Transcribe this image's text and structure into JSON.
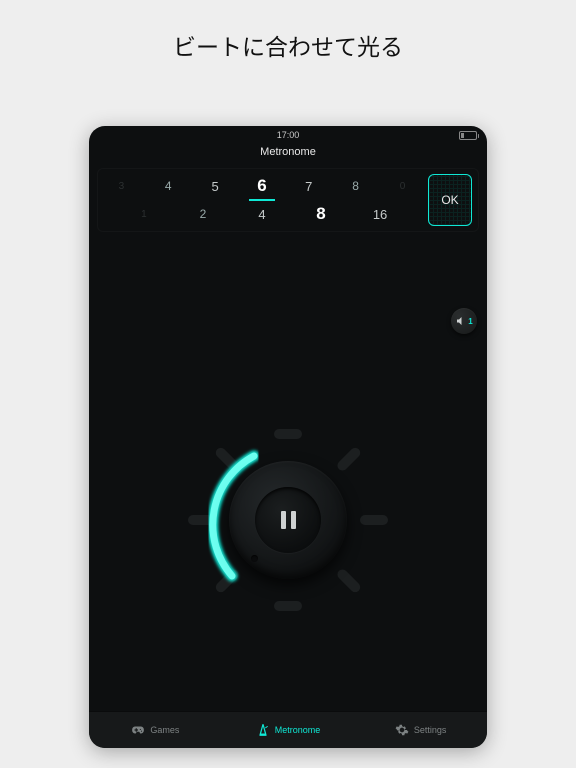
{
  "headline": "ビートに合わせて光る",
  "status": {
    "time": "17:00"
  },
  "app_title": "Metronome",
  "time_sig": {
    "top_row": [
      "3",
      "4",
      "5",
      "6",
      "7",
      "8",
      "0"
    ],
    "bottom_row": [
      "1",
      "2",
      "4",
      "8",
      "16"
    ],
    "top_selected_index": 3,
    "bottom_selected_index": 3,
    "ok_label": "OK"
  },
  "sound": {
    "count": "1"
  },
  "dial": {
    "segments": 8,
    "progress_start_deg": -150,
    "progress_end_deg": -55,
    "control_state": "pause"
  },
  "tabs": {
    "items": [
      {
        "id": "games",
        "label": "Games",
        "icon": "gamepad-icon",
        "active": false
      },
      {
        "id": "metronome",
        "label": "Metronome",
        "icon": "metronome-icon",
        "active": true
      },
      {
        "id": "settings",
        "label": "Settings",
        "icon": "gear-icon",
        "active": false
      }
    ]
  },
  "colors": {
    "accent": "#0fe8d5"
  }
}
